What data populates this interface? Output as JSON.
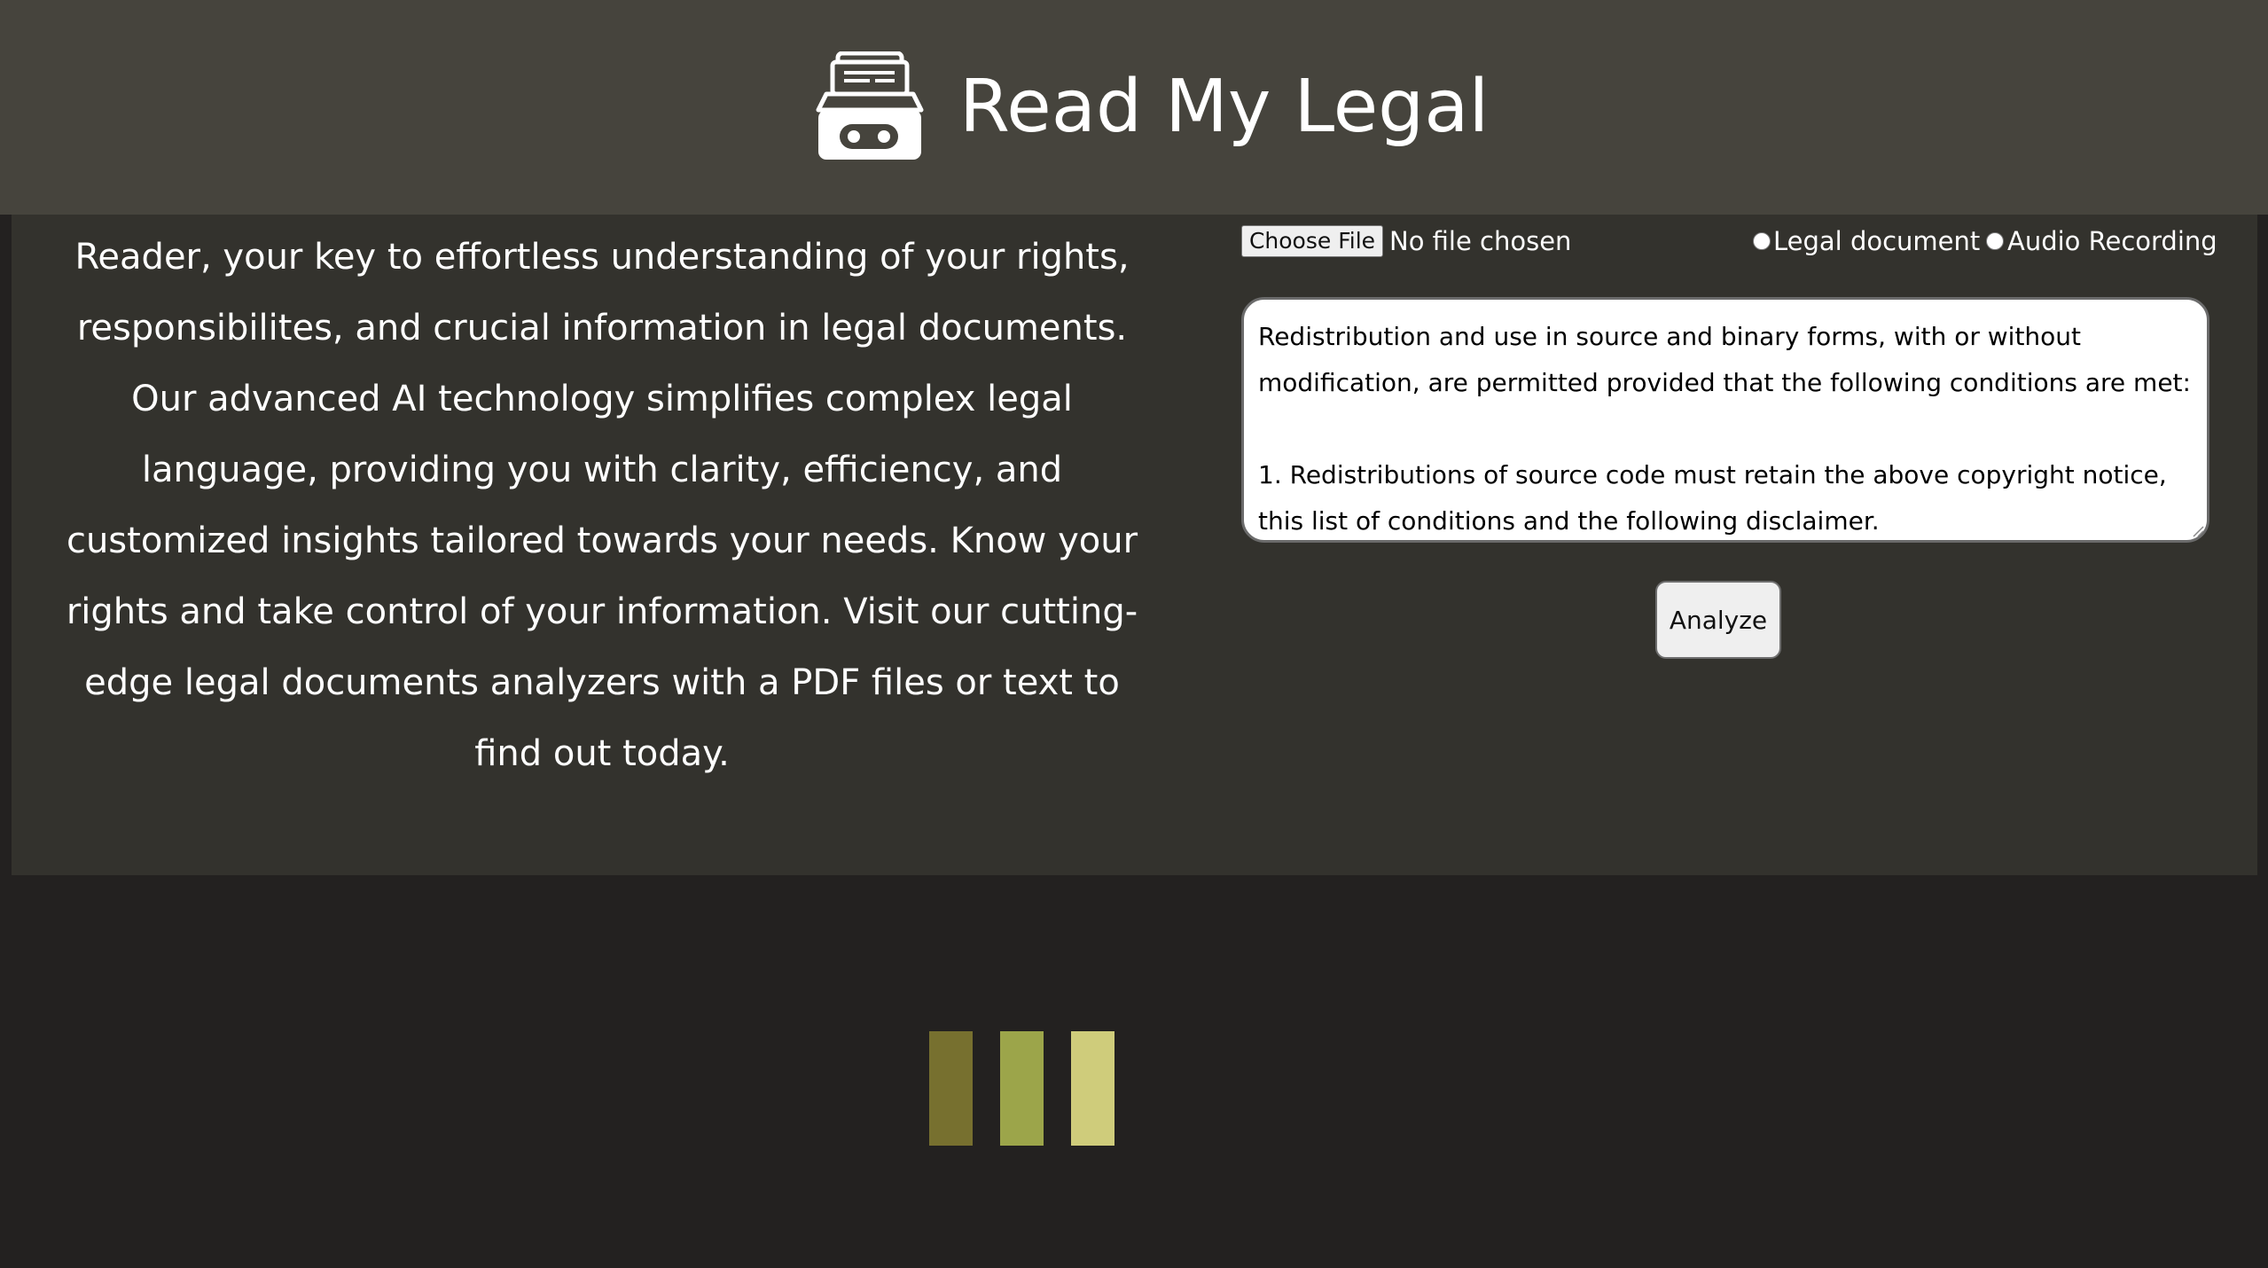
{
  "header": {
    "logo_icon": "file-cabinet-robot-icon",
    "title": "Read My Legal"
  },
  "intro": {
    "text": "Reader, your key to effortless understanding of your rights, responsibilites, and crucial information in legal documents. Our advanced AI technology simplifies complex legal language, providing you with clarity, efficiency, and customized insights tailored towards your needs. Know your rights and take control of your information. Visit our cutting-edge legal documents analyzers with a PDF files or text to find out today."
  },
  "upload": {
    "button_label": "Choose File",
    "status": "No file chosen"
  },
  "input_type": {
    "options": [
      {
        "label": "Legal document",
        "selected": false
      },
      {
        "label": "Audio Recording",
        "selected": false
      }
    ]
  },
  "document": {
    "text": "Redistribution and use in source and binary forms, with or without modification, are permitted provided that the following conditions are met:\n\n1. Redistributions of source code must retain the above copyright notice, this list of conditions and the following disclaimer."
  },
  "actions": {
    "analyze_label": "Analyze"
  },
  "loader": {
    "icon": "loading-bars-icon",
    "colors": [
      "#77702f",
      "#9ca54a",
      "#cfcc7b"
    ]
  },
  "colors": {
    "header_bg": "#46443d",
    "panel_bg": "#33322d",
    "page_bg": "#232120",
    "text": "#ffffff"
  }
}
